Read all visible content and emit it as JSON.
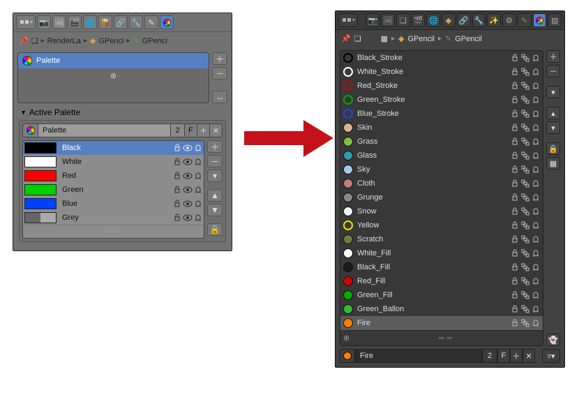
{
  "left": {
    "crumb1": "RenderLa",
    "crumb2": "GPenci",
    "crumb3": "GPenci",
    "palette_label": "Palette",
    "active_palette_label": "Active Palette",
    "datablock": {
      "name": "Palette",
      "users": "2",
      "fake": "F"
    },
    "colors": [
      {
        "name": "Black",
        "stroke": "#000000",
        "fill": "#000000",
        "selected": true
      },
      {
        "name": "White",
        "stroke": "#ffffff",
        "fill": "#ffffff",
        "selected": false
      },
      {
        "name": "Red",
        "stroke": "#ff0000",
        "fill": "#ff0000",
        "selected": false
      },
      {
        "name": "Green",
        "stroke": "#00d000",
        "fill": "#00d000",
        "selected": false
      },
      {
        "name": "Blue",
        "stroke": "#0040ff",
        "fill": "#0040ff",
        "selected": false
      },
      {
        "name": "Grey",
        "stroke": "#666666",
        "fill": "#aaaaaa",
        "selected": false
      }
    ]
  },
  "right": {
    "crumb1": "GPencil",
    "crumb2": "GPencil",
    "materials": [
      {
        "name": "Black_Stroke",
        "color": "#000000",
        "outline": true
      },
      {
        "name": "White_Stroke",
        "color": "#ffffff",
        "outline": true
      },
      {
        "name": "Red_Stroke",
        "color": "#cc0000",
        "outline": true
      },
      {
        "name": "Green_Stroke",
        "color": "#00aa00",
        "outline": true
      },
      {
        "name": "Blue_Stroke",
        "color": "#2040ff",
        "outline": true
      },
      {
        "name": "Skin",
        "color": "#d9b38c",
        "outline": false
      },
      {
        "name": "Grass",
        "color": "#7fbf3f",
        "outline": false
      },
      {
        "name": "Glass",
        "color": "#2f9cae",
        "outline": false
      },
      {
        "name": "Sky",
        "color": "#a8c8e8",
        "outline": false
      },
      {
        "name": "Cloth",
        "color": "#c47a7a",
        "outline": false
      },
      {
        "name": "Grunge",
        "color": "#888888",
        "outline": false
      },
      {
        "name": "Snow",
        "color": "#f2f2f2",
        "outline": false
      },
      {
        "name": "Yellow",
        "color": "#e6e600",
        "outline": true
      },
      {
        "name": "Scratch",
        "color": "#6b8040",
        "outline": false
      },
      {
        "name": "White_Fill",
        "color": "#ffffff",
        "outline": false
      },
      {
        "name": "Black_Fill",
        "color": "#1a1a1a",
        "outline": false
      },
      {
        "name": "Red_Fill",
        "color": "#d40000",
        "outline": false
      },
      {
        "name": "Green_Fill",
        "color": "#00aa00",
        "outline": false
      },
      {
        "name": "Green_Ballon",
        "color": "#2fbf2f",
        "outline": false
      },
      {
        "name": "Fire",
        "color": "#ff7f00",
        "outline": false,
        "selected": true
      }
    ],
    "datablock": {
      "name": "Fire",
      "users": "2",
      "fake": "F"
    }
  }
}
